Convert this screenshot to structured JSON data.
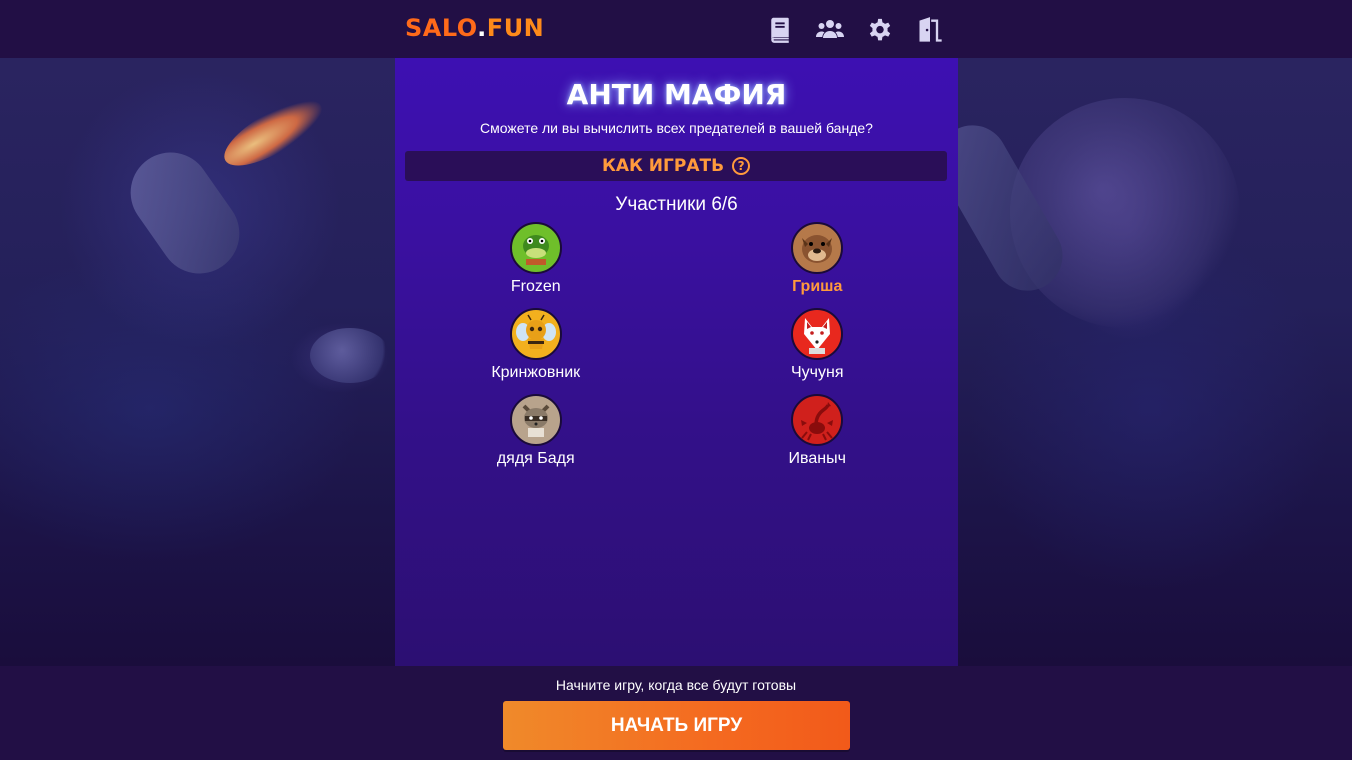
{
  "header": {
    "logo_part1": "SALO",
    "logo_dot": ".",
    "logo_part2": "FUN",
    "icons": [
      "book-icon",
      "users-icon",
      "gear-icon",
      "exit-door-icon"
    ]
  },
  "game": {
    "title": "АНТИ МАФИЯ",
    "subtitle": "Сможете ли вы вычислить всех предателей в вашей банде?",
    "how_to_play": "КАК ИГРАТЬ",
    "how_to_play_icon": "question-circle-icon",
    "participants_label": "Участники 6/6"
  },
  "players": [
    {
      "name": "Frozen",
      "avatar": "crocodile-avatar",
      "color": "#6fbf2a",
      "self": false
    },
    {
      "name": "Гриша",
      "avatar": "bulldog-avatar",
      "color": "#b5794a",
      "self": true
    },
    {
      "name": "Кринжовник",
      "avatar": "bee-avatar",
      "color": "#f2b01e",
      "self": false
    },
    {
      "name": "Чучуня",
      "avatar": "fox-avatar",
      "color": "#e8281e",
      "self": false
    },
    {
      "name": "дядя Бадя",
      "avatar": "raccoon-avatar",
      "color": "#b8a38c",
      "self": false
    },
    {
      "name": "Иваныч",
      "avatar": "scorpion-avatar",
      "color": "#d0201c",
      "self": false
    }
  ],
  "footer": {
    "hint": "Начните игру, когда все будут готовы",
    "start_button": "НАЧАТЬ ИГРУ"
  },
  "colors": {
    "accent": "#ff9a3c",
    "header_bg": "#220f45",
    "panel_bg": "#3d10b2",
    "button": "#f46a20"
  }
}
